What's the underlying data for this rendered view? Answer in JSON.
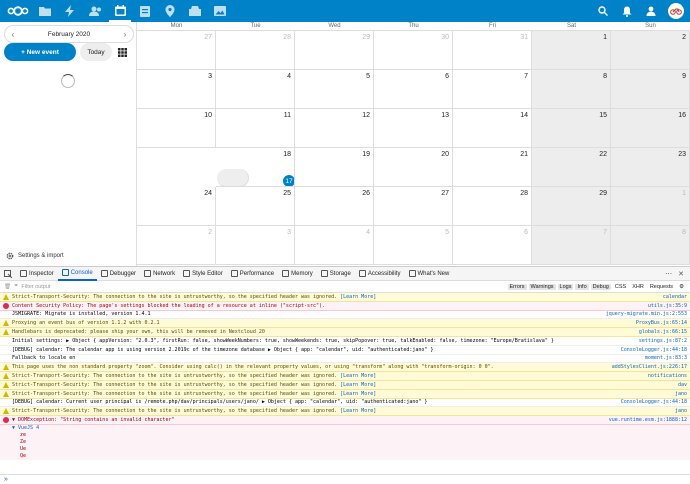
{
  "topbar": {
    "accent": "#0082c9",
    "apps": [
      "files-icon",
      "activity-icon",
      "contacts-icon",
      "calendar-icon",
      "deck-icon",
      "maps-icon",
      "notes-icon",
      "photos-icon"
    ]
  },
  "sidebar": {
    "month": "February 2020",
    "new_event": "+ New event",
    "today": "Today",
    "settings": "Settings & import"
  },
  "calendar": {
    "days": [
      "Mon",
      "Tue",
      "Wed",
      "Thu",
      "Fri",
      "Sat",
      "Sun"
    ],
    "weeks": [
      [
        "27",
        "28",
        "29",
        "30",
        "31",
        "1",
        "2"
      ],
      [
        "3",
        "4",
        "5",
        "6",
        "7",
        "8",
        "9"
      ],
      [
        "10",
        "11",
        "12",
        "13",
        "14",
        "15",
        "16"
      ],
      [
        "17",
        "18",
        "19",
        "20",
        "21",
        "22",
        "23"
      ],
      [
        "24",
        "25",
        "26",
        "27",
        "28",
        "29",
        "1"
      ],
      [
        "2",
        "3",
        "4",
        "5",
        "6",
        "7",
        "8"
      ]
    ],
    "today": "17"
  },
  "devtools": {
    "tabs": [
      "Inspector",
      "Console",
      "Debugger",
      "Network",
      "Style Editor",
      "Performance",
      "Memory",
      "Storage",
      "Accessibility",
      "What's New"
    ],
    "active_tab": "Console",
    "filter_placeholder": "Filter output",
    "filters": [
      "Errors",
      "Warnings",
      "Logs",
      "Info",
      "Debug",
      "CSS",
      "XHR",
      "Requests"
    ],
    "rows": [
      {
        "type": "warn",
        "msg": "Strict-Transport-Security: The connection to the site is untrustworthy, so the specified header was ignored.",
        "link": "[Learn More]",
        "src": "calendar"
      },
      {
        "type": "err",
        "msg": "Content Security Policy: The page's settings blocked the loading of a resource at inline (\"script-src\").",
        "link": "",
        "src": "utils.js:35:9"
      },
      {
        "type": "log",
        "msg": "JSMIGRATE: Migrate is installed, version 1.4.1",
        "link": "",
        "src": "jquery-migrate.min.js:2:553"
      },
      {
        "type": "warn",
        "msg": "Proxying an event bus of version 1.1.2 with 0.2.1",
        "link": "",
        "src": "ProxyBus.js:65:14"
      },
      {
        "type": "warn",
        "msg": "Handlebars is deprecated: please ship your own, this will be removed in Nextcloud 20",
        "link": "",
        "src": "globals.js:66:15"
      },
      {
        "type": "log",
        "msg": "Initial settings: ▶ Object { appVersion: \"2.0.3\", firstRun: false, showWeekNumbers: true, showWeekends: true, skipPopover: true, talkEnabled: false, timezone: \"Europe/Bratislava\" }",
        "link": "",
        "src": "settings.js:87:2"
      },
      {
        "type": "log",
        "msg": "[DEBUG] calendar: The calendar app is using version 2.2019c of the timezone database ▶ Object { app: \"calendar\", uid: \"authenticated:jano\" }",
        "link": "",
        "src": "ConsoleLogger.js:44:18"
      },
      {
        "type": "log",
        "msg": "Fallback to locale en",
        "link": "",
        "src": "moment.js:83:3"
      },
      {
        "type": "warn",
        "msg": "This page uses the non standard property \"zoom\". Consider using calc() in the relevant property values, or using \"transform\" along with \"transform-origin: 0 0\".",
        "link": "",
        "src": "addStylesClient.js:226:17"
      },
      {
        "type": "warn",
        "msg": "Strict-Transport-Security: The connection to the site is untrustworthy, so the specified header was ignored.",
        "link": "[Learn More]",
        "src": "notifications"
      },
      {
        "type": "warn",
        "msg": "Strict-Transport-Security: The connection to the site is untrustworthy, so the specified header was ignored.",
        "link": "[Learn More]",
        "src": "dav"
      },
      {
        "type": "warn",
        "msg": "Strict-Transport-Security: The connection to the site is untrustworthy, so the specified header was ignored.",
        "link": "[Learn More]",
        "src": "jano"
      },
      {
        "type": "log",
        "msg": "[DEBUG] calendar: Current user principal is /remote.php/dav/principals/users/jano/ ▶ Object { app: \"calendar\", uid: \"authenticated:jano\" }",
        "link": "",
        "src": "ConsoleLogger.js:44:18"
      },
      {
        "type": "warn",
        "msg": "Strict-Transport-Security: The connection to the site is untrustworthy, so the specified header was ignored.",
        "link": "[Learn More]",
        "src": "jano"
      },
      {
        "type": "err",
        "msg": "▼ DOMException: \"String contains an invalid character\"",
        "link": "",
        "src": "vue.runtime.esm.js:1888:12"
      }
    ],
    "stack_head": "▼ VueJS 4",
    "stack": [
      "ze",
      "Ze",
      "Ue",
      "Qe"
    ],
    "prompt": "»"
  }
}
